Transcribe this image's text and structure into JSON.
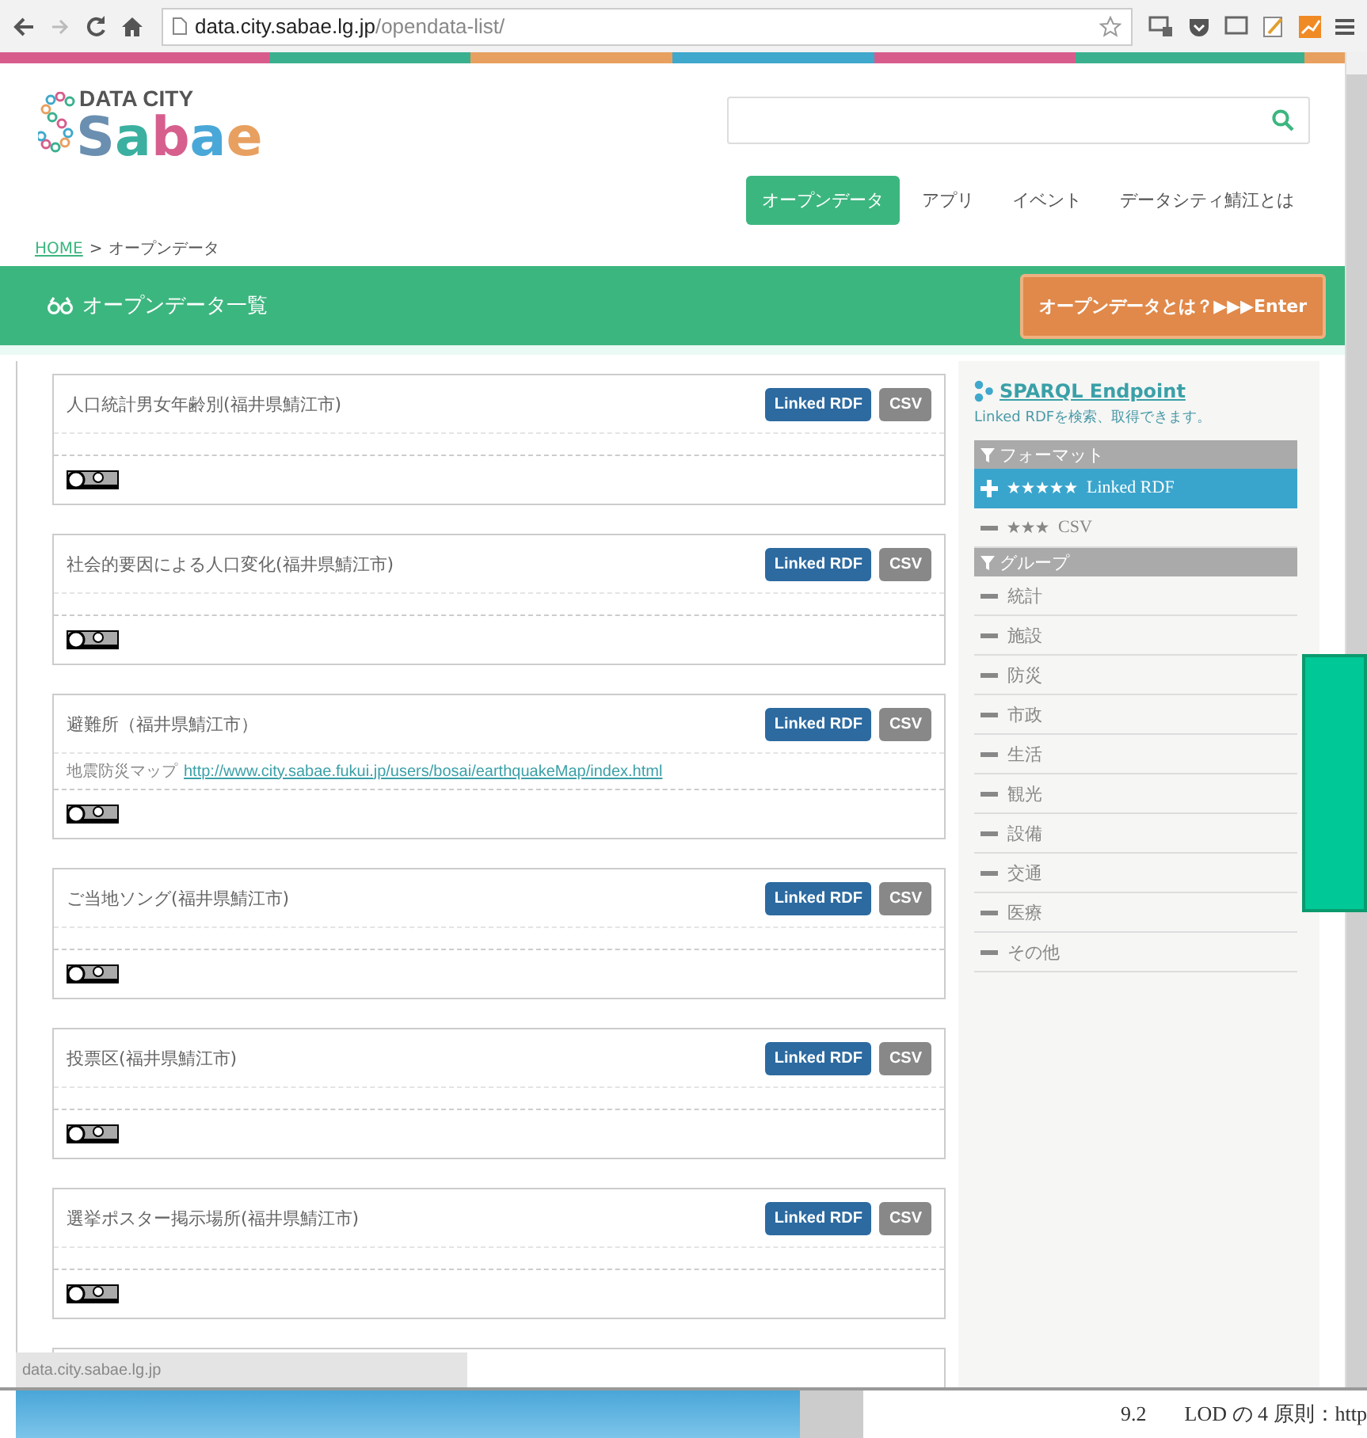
{
  "browser": {
    "address_host": "data.city.sabae.lg.jp",
    "address_path": "/opendata-list/",
    "status_text": "data.city.sabae.lg.jp"
  },
  "header": {
    "logo_top": "DATA CITY",
    "logo_main": "Sabae",
    "nav": [
      {
        "label": "オープンデータ",
        "selected": true
      },
      {
        "label": "アプリ",
        "selected": false
      },
      {
        "label": "イベント",
        "selected": false
      },
      {
        "label": "データシティ鯖江とは",
        "selected": false
      }
    ]
  },
  "breadcrumb": {
    "link": "HOME",
    "separator": ">",
    "current": "オープンデータ"
  },
  "banner": {
    "title": "オープンデータ一覧",
    "button": "オープンデータとは？▶▶▶Enter"
  },
  "datasets": [
    {
      "title": "人口統計男女年齢別(福井県鯖江市)",
      "buttons": [
        "Linked RDF",
        "CSV"
      ]
    },
    {
      "title": "社会的要因による人口変化(福井県鯖江市)",
      "buttons": [
        "Linked RDF",
        "CSV"
      ]
    },
    {
      "title": "避難所（福井県鯖江市）",
      "note": {
        "label": "地震防災マップ",
        "url": "http://www.city.sabae.fukui.jp/users/bosai/earthquakeMap/index.html"
      },
      "buttons": [
        "Linked RDF",
        "CSV"
      ]
    },
    {
      "title": "ご当地ソング(福井県鯖江市)",
      "buttons": [
        "Linked RDF",
        "CSV"
      ]
    },
    {
      "title": "投票区(福井県鯖江市)",
      "buttons": [
        "Linked RDF",
        "CSV"
      ]
    },
    {
      "title": "選挙ポスター掲示場所(福井県鯖江市)",
      "buttons": [
        "Linked RDF",
        "CSV"
      ]
    }
  ],
  "sidebar": {
    "sparql": {
      "title": "SPARQL Endpoint",
      "description": "Linked RDFを検索、取得できます。"
    },
    "facets": [
      {
        "heading": "フォーマット",
        "items": [
          {
            "label": "Linked RDF",
            "stars": 5,
            "selected": true
          },
          {
            "label": "CSV",
            "stars": 3,
            "selected": false
          }
        ]
      },
      {
        "heading": "グループ",
        "items": [
          {
            "label": "統計",
            "selected": false
          },
          {
            "label": "施設",
            "selected": false
          },
          {
            "label": "防災",
            "selected": false
          },
          {
            "label": "市政",
            "selected": false
          },
          {
            "label": "生活",
            "selected": false
          },
          {
            "label": "観光",
            "selected": false
          },
          {
            "label": "設備",
            "selected": false
          },
          {
            "label": "交通",
            "selected": false
          },
          {
            "label": "医療",
            "selected": false
          },
          {
            "label": "その他",
            "selected": false
          }
        ]
      }
    ]
  },
  "background_document": {
    "number": "9.2",
    "text": "LOD の 4 原則：http"
  }
}
